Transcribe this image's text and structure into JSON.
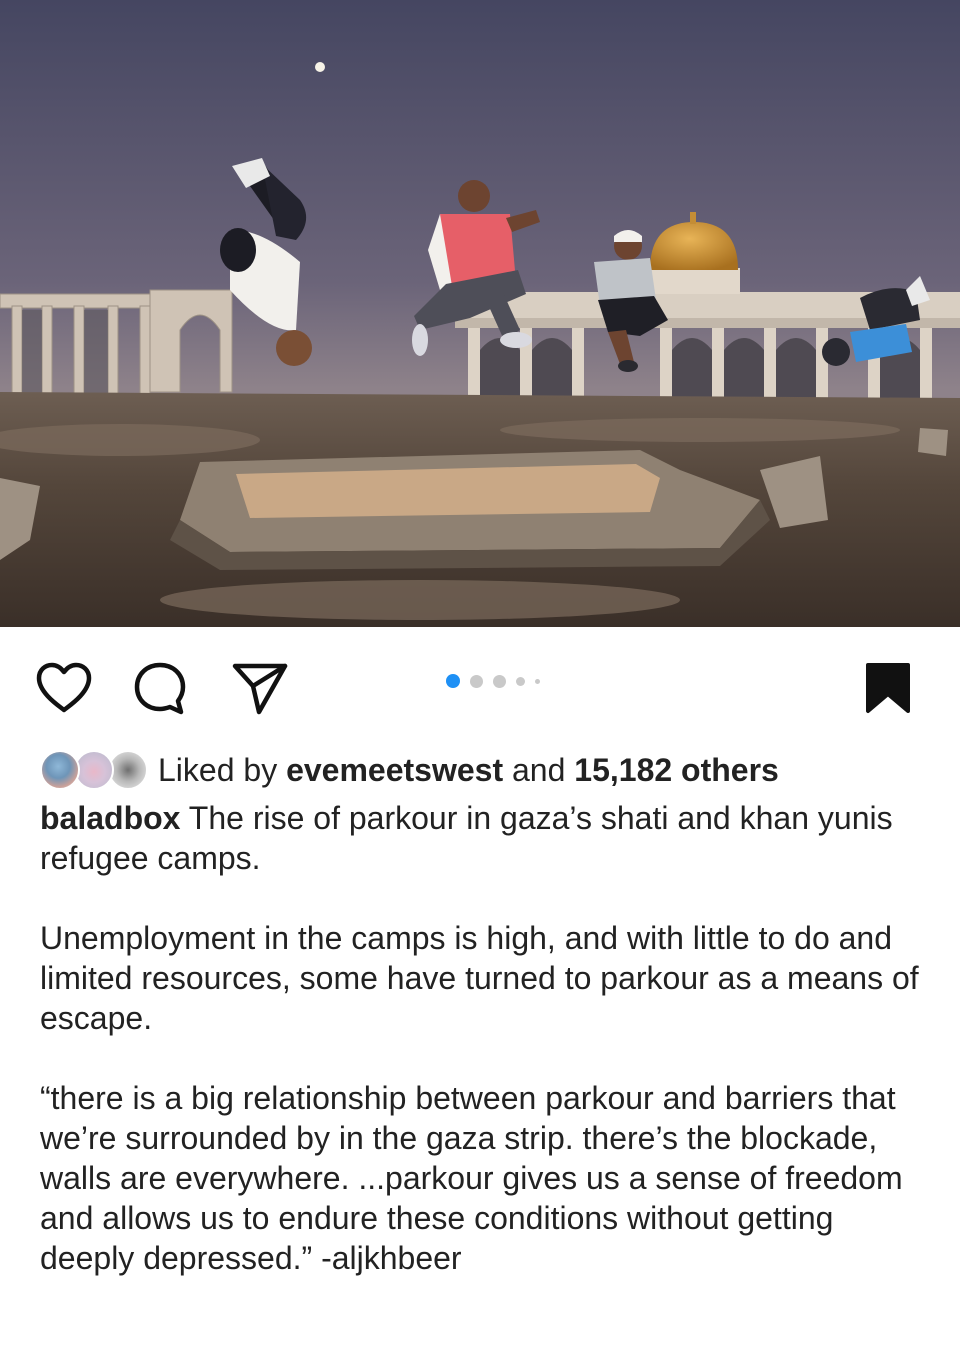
{
  "post": {
    "image_alt": "Young men doing parkour flips in front of a ruined airport terminal with a golden dome at dusk",
    "carousel": {
      "total": 5,
      "active_index": 0
    }
  },
  "actions": {
    "like_icon": "heart-icon",
    "comment_icon": "comment-icon",
    "share_icon": "paper-plane-icon",
    "save_icon": "bookmark-filled-icon"
  },
  "likes": {
    "prefix": "Liked by",
    "user": "evemeetswest",
    "connector": "and",
    "others": "15,182 others"
  },
  "caption": {
    "username": "baladbox",
    "text1": "The rise of parkour in gaza’s shati and khan yunis refugee camps.",
    "para2": "Unemployment in the camps is high, and with little to do and limited resources, some have turned to parkour as a means of escape.",
    "para3": "“there is a big relationship between parkour and barriers that we’re surrounded by in the gaza strip. there’s the blockade, walls are everywhere. ...parkour gives us a sense of freedom and allows us to endure these conditions without getting deeply depressed.” -aljkhbeer"
  },
  "colors": {
    "accent": "#1e90f5",
    "text": "#222222",
    "icon": "#111111",
    "dot_inactive": "#c9c9c9"
  }
}
